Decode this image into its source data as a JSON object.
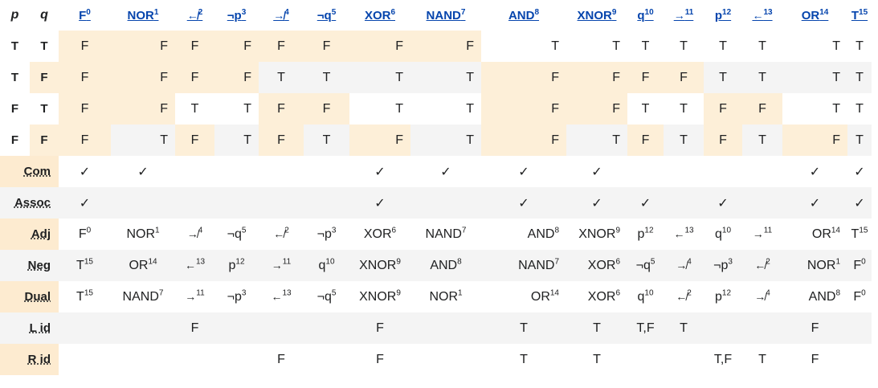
{
  "header": {
    "p": "p",
    "q": "q",
    "cols": [
      {
        "name": "F",
        "num": "0"
      },
      {
        "name": "NOR",
        "num": "1"
      },
      {
        "name": "↚",
        "num": "2"
      },
      {
        "name": "¬p",
        "num": "3"
      },
      {
        "name": "↛",
        "num": "4"
      },
      {
        "name": "¬q",
        "num": "5"
      },
      {
        "name": "XOR",
        "num": "6"
      },
      {
        "name": "NAND",
        "num": "7"
      },
      {
        "name": "AND",
        "num": "8"
      },
      {
        "name": "XNOR",
        "num": "9"
      },
      {
        "name": "q",
        "num": "10"
      },
      {
        "name": "→",
        "num": "11"
      },
      {
        "name": "p",
        "num": "12"
      },
      {
        "name": "←",
        "num": "13"
      },
      {
        "name": "OR",
        "num": "14"
      },
      {
        "name": "T",
        "num": "15"
      }
    ]
  },
  "truth_rows": [
    {
      "p": "T",
      "q": "T",
      "vals": [
        "F",
        "F",
        "F",
        "F",
        "F",
        "F",
        "F",
        "F",
        "T",
        "T",
        "T",
        "T",
        "T",
        "T",
        "T",
        "T"
      ]
    },
    {
      "p": "T",
      "q": "F",
      "vals": [
        "F",
        "F",
        "F",
        "F",
        "T",
        "T",
        "T",
        "T",
        "F",
        "F",
        "F",
        "F",
        "T",
        "T",
        "T",
        "T"
      ]
    },
    {
      "p": "F",
      "q": "T",
      "vals": [
        "F",
        "F",
        "T",
        "T",
        "F",
        "F",
        "T",
        "T",
        "F",
        "F",
        "T",
        "T",
        "F",
        "F",
        "T",
        "T"
      ]
    },
    {
      "p": "F",
      "q": "F",
      "vals": [
        "F",
        "T",
        "F",
        "T",
        "F",
        "T",
        "F",
        "T",
        "F",
        "T",
        "F",
        "T",
        "F",
        "T",
        "F",
        "T"
      ]
    }
  ],
  "prop_rows": [
    {
      "label": "Com",
      "vals": [
        "✓",
        "✓",
        "",
        "",
        "",
        "",
        "✓",
        "✓",
        "✓",
        "✓",
        "",
        "",
        "",
        "",
        "✓",
        "✓"
      ]
    },
    {
      "label": "Assoc",
      "vals": [
        "✓",
        "",
        "",
        "",
        "",
        "",
        "✓",
        "",
        "✓",
        "✓",
        "✓",
        "",
        "✓",
        "",
        "✓",
        "✓"
      ]
    },
    {
      "label": "Adj",
      "vals": [
        {
          "name": "F",
          "num": "0"
        },
        {
          "name": "NOR",
          "num": "1"
        },
        {
          "name": "↛",
          "num": "4"
        },
        {
          "name": "¬q",
          "num": "5"
        },
        {
          "name": "↚",
          "num": "2"
        },
        {
          "name": "¬p",
          "num": "3"
        },
        {
          "name": "XOR",
          "num": "6"
        },
        {
          "name": "NAND",
          "num": "7"
        },
        {
          "name": "AND",
          "num": "8"
        },
        {
          "name": "XNOR",
          "num": "9"
        },
        {
          "name": "p",
          "num": "12"
        },
        {
          "name": "←",
          "num": "13"
        },
        {
          "name": "q",
          "num": "10"
        },
        {
          "name": "→",
          "num": "11"
        },
        {
          "name": "OR",
          "num": "14"
        },
        {
          "name": "T",
          "num": "15"
        }
      ]
    },
    {
      "label": "Neg",
      "vals": [
        {
          "name": "T",
          "num": "15"
        },
        {
          "name": "OR",
          "num": "14"
        },
        {
          "name": "←",
          "num": "13"
        },
        {
          "name": "p",
          "num": "12"
        },
        {
          "name": "→",
          "num": "11"
        },
        {
          "name": "q",
          "num": "10"
        },
        {
          "name": "XNOR",
          "num": "9"
        },
        {
          "name": "AND",
          "num": "8"
        },
        {
          "name": "NAND",
          "num": "7"
        },
        {
          "name": "XOR",
          "num": "6"
        },
        {
          "name": "¬q",
          "num": "5"
        },
        {
          "name": "↛",
          "num": "4"
        },
        {
          "name": "¬p",
          "num": "3"
        },
        {
          "name": "↚",
          "num": "2"
        },
        {
          "name": "NOR",
          "num": "1"
        },
        {
          "name": "F",
          "num": "0"
        }
      ]
    },
    {
      "label": "Dual",
      "vals": [
        {
          "name": "T",
          "num": "15"
        },
        {
          "name": "NAND",
          "num": "7"
        },
        {
          "name": "→",
          "num": "11"
        },
        {
          "name": "¬p",
          "num": "3"
        },
        {
          "name": "←",
          "num": "13"
        },
        {
          "name": "¬q",
          "num": "5"
        },
        {
          "name": "XNOR",
          "num": "9"
        },
        {
          "name": "NOR",
          "num": "1"
        },
        {
          "name": "OR",
          "num": "14"
        },
        {
          "name": "XOR",
          "num": "6"
        },
        {
          "name": "q",
          "num": "10"
        },
        {
          "name": "↚",
          "num": "2"
        },
        {
          "name": "p",
          "num": "12"
        },
        {
          "name": "↛",
          "num": "4"
        },
        {
          "name": "AND",
          "num": "8"
        },
        {
          "name": "F",
          "num": "0"
        }
      ]
    },
    {
      "label": "L id",
      "vals": [
        "",
        "",
        "F",
        "",
        "",
        "",
        "F",
        "",
        "T",
        "T",
        "T,F",
        "T",
        "",
        "",
        "F",
        ""
      ]
    },
    {
      "label": "R id",
      "vals": [
        "",
        "",
        "",
        "",
        "F",
        "",
        "F",
        "",
        "T",
        "T",
        "",
        "",
        "T,F",
        "T",
        "F",
        ""
      ]
    }
  ]
}
